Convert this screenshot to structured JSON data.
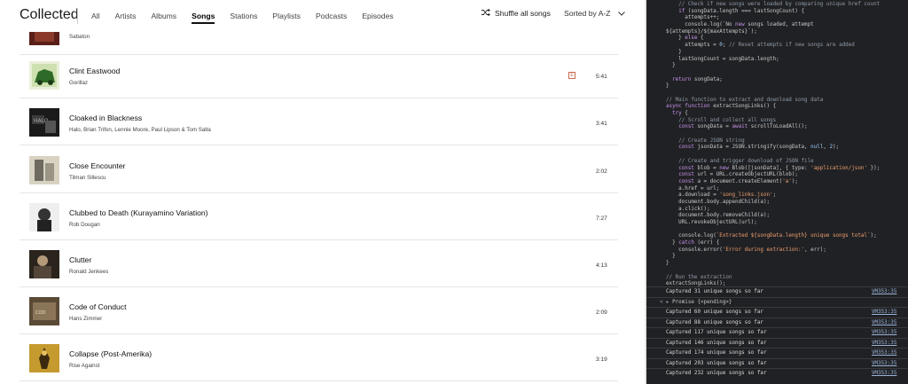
{
  "app": {
    "title": "Collected",
    "tabs": [
      "All",
      "Artists",
      "Albums",
      "Songs",
      "Stations",
      "Playlists",
      "Podcasts",
      "Episodes"
    ],
    "active_tab": "Songs",
    "shuffle_label": "Shuffle all songs",
    "sort_label": "Sorted by A-Z"
  },
  "songs": [
    {
      "title": "",
      "artist": "Sabaton",
      "duration": "",
      "explicit": false
    },
    {
      "title": "Clint Eastwood",
      "artist": "Gorillaz",
      "duration": "5:41",
      "explicit": true
    },
    {
      "title": "Cloaked in Blackness",
      "artist": "Halo, Brian Trifon, Lennie Moore, Paul Lipson & Tom Salta",
      "duration": "3:41",
      "explicit": false
    },
    {
      "title": "Close Encounter",
      "artist": "Tilman Sillescu",
      "duration": "2:02",
      "explicit": false
    },
    {
      "title": "Clubbed to Death (Kurayamino Variation)",
      "artist": "Rob Dougan",
      "duration": "7:27",
      "explicit": false
    },
    {
      "title": "Clutter",
      "artist": "Ronald Jenkees",
      "duration": "4:13",
      "explicit": false
    },
    {
      "title": "Code of Conduct",
      "artist": "Hans Zimmer",
      "duration": "2:09",
      "explicit": false
    },
    {
      "title": "Collapse (Post-Amerika)",
      "artist": "Rise Against",
      "duration": "3:19",
      "explicit": false
    }
  ],
  "explicit_label": "E",
  "devtools": {
    "code_lines": [
      "    // Check if new songs were loaded by comparing unique href count",
      "    if (songData.length === lastSongCount) {",
      "      attempts++;",
      "      console.log(`No new songs loaded, attempt",
      "${attempts}/${maxAttempts}`);",
      "    } else {",
      "      attempts = 0; // Reset attempts if new songs are added",
      "    }",
      "    lastSongCount = songData.length;",
      "  }",
      "",
      "  return songData;",
      "}",
      "",
      "// Main function to extract and download song data",
      "async function extractSongLinks() {",
      "  try {",
      "    // Scroll and collect all songs",
      "    const songData = await scrollToLoadAll();",
      "",
      "    // Create JSON string",
      "    const jsonData = JSON.stringify(songData, null, 2);",
      "",
      "    // Create and trigger download of JSON file",
      "    const blob = new Blob([jsonData], { type: 'application/json' });",
      "    const url = URL.createObjectURL(blob);",
      "    const a = document.createElement('a');",
      "    a.href = url;",
      "    a.download = 'song_links.json';",
      "    document.body.appendChild(a);",
      "    a.click();",
      "    document.body.removeChild(a);",
      "    URL.revokeObjectURL(url);",
      "",
      "    console.log(`Extracted ${songData.length} unique songs total`);",
      "  } catch (err) {",
      "    console.error('Error during extraction:', err);",
      "  }",
      "}",
      "",
      "// Run the extraction",
      "extractSongLinks();"
    ],
    "console": [
      {
        "type": "log",
        "text": "Captured 31 unique songs so far",
        "source": "VM353:35"
      },
      {
        "type": "promise",
        "text": "▸ Promise {<pending>}",
        "source": ""
      },
      {
        "type": "log",
        "text": "Captured 60 unique songs so far",
        "source": "VM353:35"
      },
      {
        "type": "log",
        "text": "Captured 88 unique songs so far",
        "source": "VM353:35"
      },
      {
        "type": "log",
        "text": "Captured 117 unique songs so far",
        "source": "VM353:35"
      },
      {
        "type": "log",
        "text": "Captured 146 unique songs so far",
        "source": "VM353:35"
      },
      {
        "type": "log",
        "text": "Captured 174 unique songs so far",
        "source": "VM353:35"
      },
      {
        "type": "log",
        "text": "Captured 203 unique songs so far",
        "source": "VM353:35"
      },
      {
        "type": "log",
        "text": "Captured 232 unique songs so far",
        "source": "VM353:35"
      }
    ],
    "prompt_symbol": "<",
    "colors": {
      "keyword": "#c792ea",
      "function": "#82aaff",
      "string": "#f0a070",
      "comment": "#8f9ba8",
      "link": "#9ab3d8"
    }
  },
  "icons": {
    "shuffle": "shuffle-icon",
    "sort": "chevron-down-icon"
  }
}
